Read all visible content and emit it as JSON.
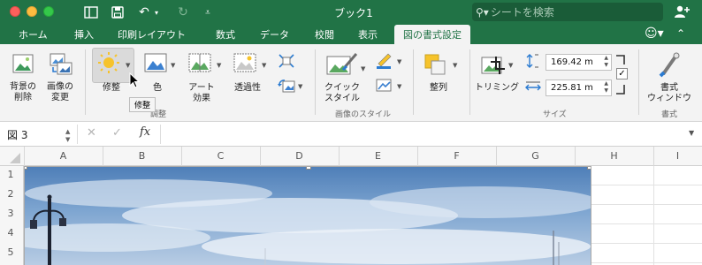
{
  "window": {
    "title": "ブック1",
    "search_placeholder": "シートを検索"
  },
  "tabs": [
    "ホーム",
    "挿入",
    "印刷レイアウト",
    "数式",
    "データ",
    "校閲",
    "表示",
    "図の書式設定"
  ],
  "active_tab": "図の書式設定",
  "ribbon": {
    "remove_bg_line1": "背景の",
    "remove_bg_line2": "削除",
    "change_pic_line1": "画像の",
    "change_pic_line2": "変更",
    "corrections": "修整",
    "color": "色",
    "artistic_line1": "アート",
    "artistic_line2": "効果",
    "transparency": "透過性",
    "adjust_group": "調整",
    "quick_styles_line1": "クイック",
    "quick_styles_line2": "スタイル",
    "picture_styles_group": "画像のスタイル",
    "arrange": "整列",
    "crop": "トリミング",
    "height_value": "169.42 m",
    "width_value": "225.81 m",
    "size_group": "サイズ",
    "format_pane_line1": "書式",
    "format_pane_line2": "ウィンドウ",
    "format_group": "書式",
    "tooltip": "修整"
  },
  "formula_bar": {
    "name_box": "図 3",
    "fx": "fx"
  },
  "sheet": {
    "columns": [
      "A",
      "B",
      "C",
      "D",
      "E",
      "F",
      "G",
      "H",
      "I"
    ],
    "rows": [
      "1",
      "2",
      "3",
      "4",
      "5"
    ]
  },
  "colors": {
    "brand": "#217346",
    "ribbon_bg": "#f3f3f3"
  }
}
